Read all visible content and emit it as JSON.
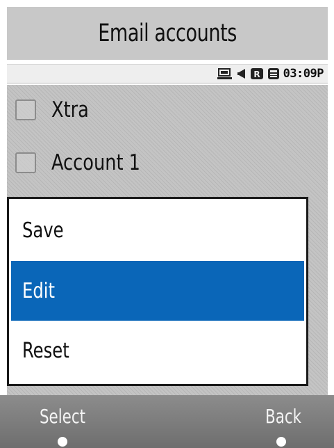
{
  "header": {
    "title": "Email accounts"
  },
  "status_bar": {
    "time": "03:09P",
    "icons": [
      "network-icon",
      "speaker-icon",
      "roaming-r-icon",
      "battery-icon"
    ]
  },
  "accounts": [
    {
      "label": "Xtra",
      "checked": false
    },
    {
      "label": "Account 1",
      "checked": false
    }
  ],
  "popup_menu": {
    "items": [
      {
        "label": "Save",
        "selected": false
      },
      {
        "label": "Edit",
        "selected": true
      },
      {
        "label": "Reset",
        "selected": false
      }
    ]
  },
  "softkeys": {
    "left": "Select",
    "right": "Back"
  },
  "colors": {
    "selected_highlight": "#0a66b8",
    "title_bar": "#c8c8c8",
    "softkey_bar": "#7a7a7a"
  }
}
